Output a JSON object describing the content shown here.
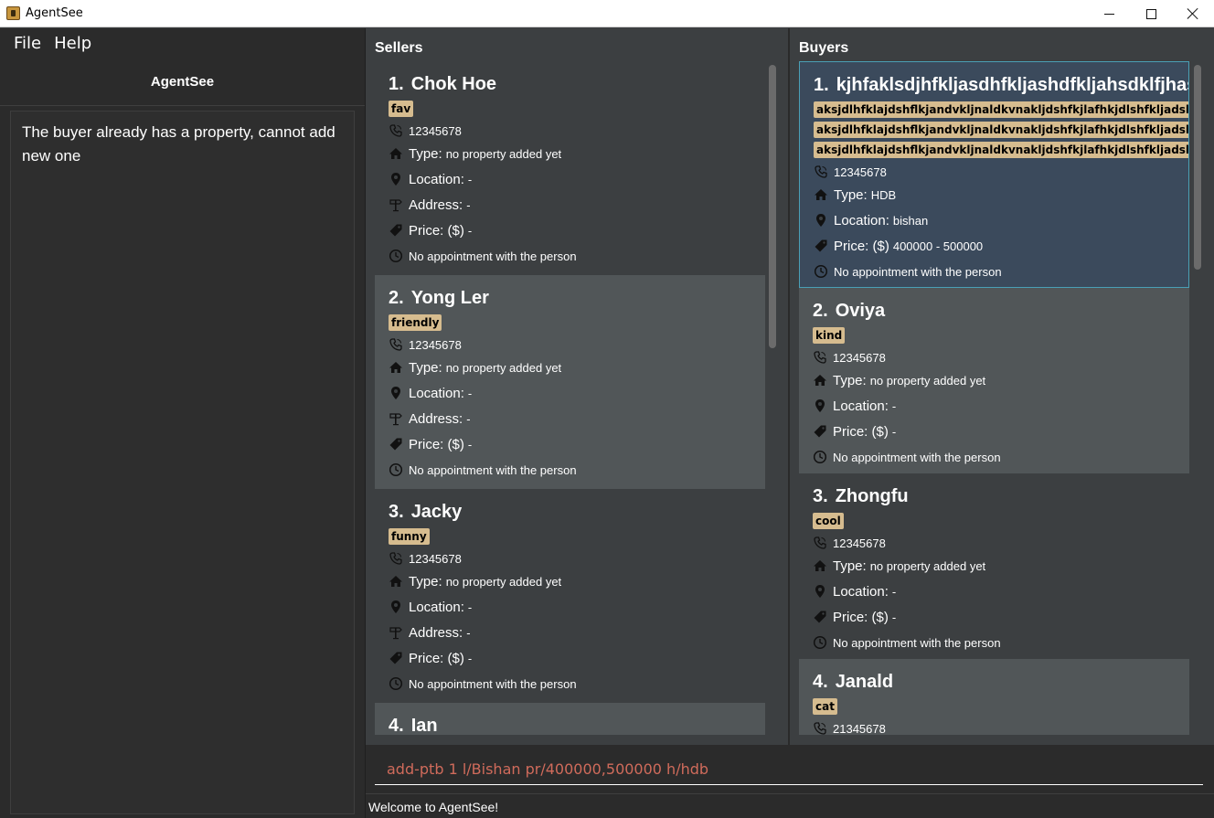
{
  "window": {
    "title": "AgentSee"
  },
  "menu": {
    "file": "File",
    "help": "Help"
  },
  "app_heading": "AgentSee",
  "result_message": "The buyer already has a property, cannot add new one",
  "labels": {
    "type": "Type:",
    "location": "Location:",
    "address": "Address:",
    "price": "Price: ($)"
  },
  "sellers": {
    "title": "Sellers",
    "items": [
      {
        "index": "1.",
        "name": "Chok Hoe",
        "tags": [
          "fav"
        ],
        "phone": "12345678",
        "type": "no property added yet",
        "location": "-",
        "address": "-",
        "price": "-",
        "appointment": "No appointment with the person"
      },
      {
        "index": "2.",
        "name": "Yong Ler",
        "tags": [
          "friendly"
        ],
        "phone": "12345678",
        "type": "no property added yet",
        "location": "-",
        "address": "-",
        "price": "-",
        "appointment": "No appointment with the person"
      },
      {
        "index": "3.",
        "name": "Jacky",
        "tags": [
          "funny"
        ],
        "phone": "12345678",
        "type": "no property added yet",
        "location": "-",
        "address": "-",
        "price": "-",
        "appointment": "No appointment with the person"
      },
      {
        "index": "4.",
        "name": "Ian"
      }
    ]
  },
  "buyers": {
    "title": "Buyers",
    "items": [
      {
        "index": "1.",
        "name": "kjhfaklsdjhfkljasdhfkljashdfkljahsdklfjhasldkjfhalskjdfhlaksjdhf",
        "tags": [
          "aksjdlhfklajdshflkjandvkljnaldkvnakljdshfkjlafhkjdlshfkljadshvkljadsvdsaksjdhf",
          "aksjdlhfklajdshflkjandvkljnaldkvnakljdshfkjlafhkjdlshfkljadshvkljadsvdsaksjdhf",
          "aksjdlhfklajdshflkjandvkljnaldkvnakljdshfkjlafhkjdlshfkljadshvkljadsvdsaksjdhf"
        ],
        "phone": "12345678",
        "type": "HDB",
        "location": "bishan",
        "price": "400000 - 500000",
        "appointment": "No appointment with the person"
      },
      {
        "index": "2.",
        "name": "Oviya",
        "tags": [
          "kind"
        ],
        "phone": "12345678",
        "type": "no property added yet",
        "location": "-",
        "price": "-",
        "appointment": "No appointment with the person"
      },
      {
        "index": "3.",
        "name": "Zhongfu",
        "tags": [
          "cool"
        ],
        "phone": "12345678",
        "type": "no property added yet",
        "location": "-",
        "price": "-",
        "appointment": "No appointment with the person"
      },
      {
        "index": "4.",
        "name": "Janald",
        "tags": [
          "cat"
        ],
        "phone": "21345678"
      }
    ]
  },
  "command": {
    "value": "add-ptb 1 l/Bishan pr/400000,500000 h/hdb"
  },
  "status": "Welcome to AgentSee!",
  "icons": {
    "phone": "phone-icon",
    "type": "home-icon",
    "location": "location-pin-icon",
    "address": "signpost-icon",
    "price": "price-tag-icon",
    "appointment": "clock-icon"
  },
  "colors": {
    "tag_bg": "#d6bc8f",
    "command_text": "#d06b5b",
    "selected_border": "#4a9fb5"
  }
}
